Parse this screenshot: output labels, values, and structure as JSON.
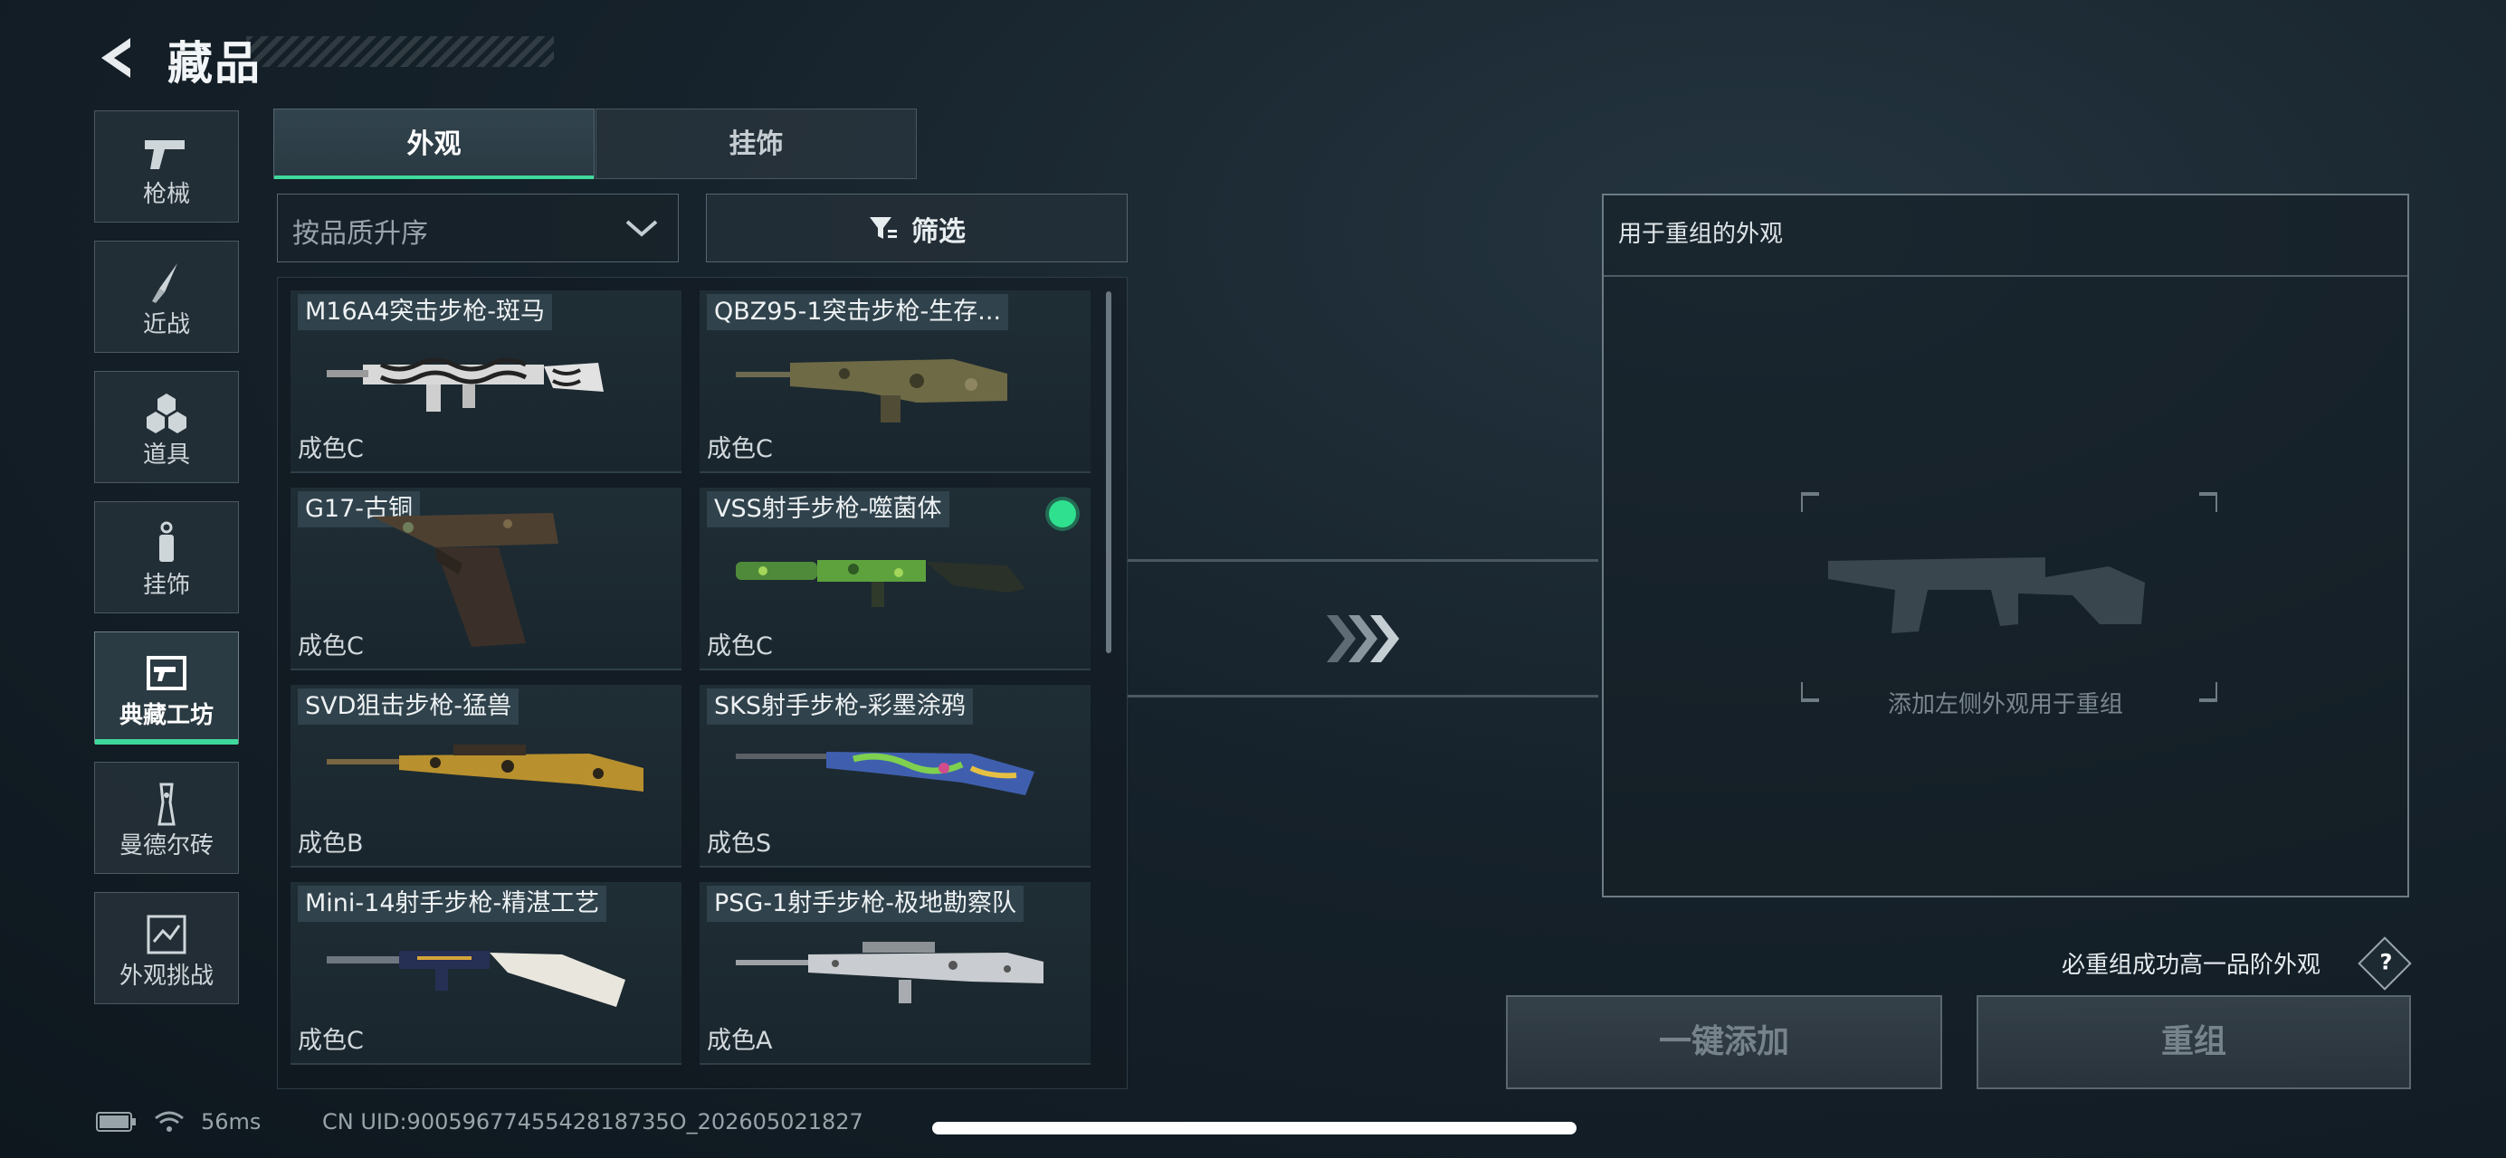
{
  "header": {
    "title": "藏品"
  },
  "categories": [
    {
      "label": "枪械",
      "icon": "pistol-icon"
    },
    {
      "label": "近战",
      "icon": "knife-icon"
    },
    {
      "label": "道具",
      "icon": "items-icon"
    },
    {
      "label": "挂饰",
      "icon": "charm-icon"
    },
    {
      "label": "典藏工坊",
      "icon": "workshop-icon",
      "active": true
    },
    {
      "label": "曼德尔砖",
      "icon": "brick-icon"
    },
    {
      "label": "外观挑战",
      "icon": "challenge-icon"
    }
  ],
  "tabs": [
    {
      "label": "外观",
      "active": true
    },
    {
      "label": "挂饰",
      "active": false
    }
  ],
  "sort": {
    "value": "按品质升序"
  },
  "filter": {
    "label": "筛选"
  },
  "items": [
    {
      "name": "M16A4突击步枪-斑马",
      "grade": "成色C",
      "selected": false
    },
    {
      "name": "QBZ95-1突击步枪-生存...",
      "grade": "成色C",
      "selected": false
    },
    {
      "name": "G17-古铜",
      "grade": "成色C",
      "selected": false
    },
    {
      "name": "VSS射手步枪-噬菌体",
      "grade": "成色C",
      "selected": true
    },
    {
      "name": "SVD狙击步枪-猛兽",
      "grade": "成色B",
      "selected": false
    },
    {
      "name": "SKS射手步枪-彩墨涂鸦",
      "grade": "成色S",
      "selected": false
    },
    {
      "name": "Mini-14射手步枪-精湛工艺",
      "grade": "成色C",
      "selected": false
    },
    {
      "name": "PSG-1射手步枪-极地勘察队",
      "grade": "成色A",
      "selected": false
    }
  ],
  "panel": {
    "title": "用于重组的外观",
    "hint": "添加左侧外观用于重组"
  },
  "guarantee": "必重组成功高一品阶外观",
  "help_label": "?",
  "buttons": {
    "add_all": "一键添加",
    "recombine": "重组"
  },
  "status": {
    "ping": "56ms",
    "uid": "CN UID:9005967745542818735O_202605021827"
  },
  "colors": {
    "accent": "#3fd99b",
    "selected_dot": "#2fe08f"
  }
}
